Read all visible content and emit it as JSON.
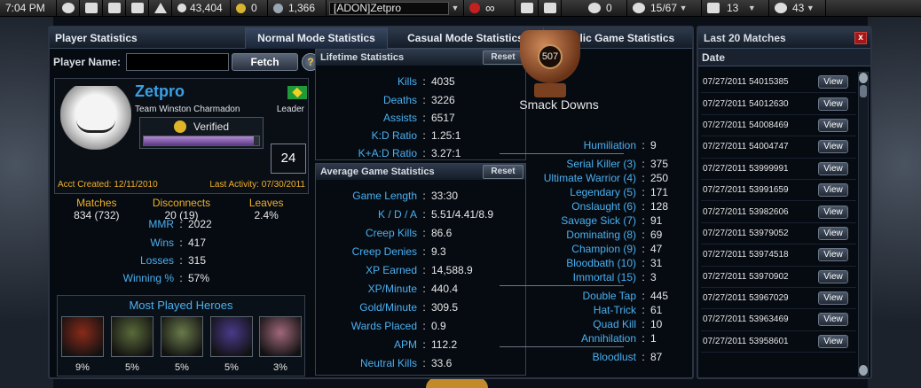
{
  "topbar": {
    "time": "7:04 PM",
    "gold": "43,404",
    "coins": "0",
    "silver": "1,366",
    "nickname": "[ADON]Zetpro",
    "infinity": "∞",
    "messages": "0",
    "friends": "15/67",
    "clan": "13",
    "notices": "43"
  },
  "tabs": {
    "player_statistics": "Player Statistics",
    "normal": "Normal Mode Statistics",
    "casual": "Casual Mode Statistics",
    "public": "Public Game Statistics"
  },
  "fetch": {
    "label": "Player Name:",
    "value": "",
    "button": "Fetch",
    "help": "?"
  },
  "player": {
    "name": "Zetpro",
    "team": "Team Winston Charmadon",
    "role": "Leader",
    "verified": "Verified",
    "level": "24",
    "level_progress": 0.95,
    "acct_created_label": "Acct Created:",
    "acct_created": "12/11/2010",
    "last_activity_label": "Last Activity:",
    "last_activity": "07/30/2011"
  },
  "summary": [
    {
      "label": "Matches",
      "value": "834 (732)"
    },
    {
      "label": "Disconnects",
      "value": "20 (19)"
    },
    {
      "label": "Leaves",
      "value": "2.4%"
    }
  ],
  "rating": [
    {
      "label": "MMR",
      "value": "2022"
    },
    {
      "label": "Wins",
      "value": "417"
    },
    {
      "label": "Losses",
      "value": "315"
    },
    {
      "label": "Winning %",
      "value": "57%"
    }
  ],
  "heroes": {
    "title": "Most Played Heroes",
    "items": [
      {
        "pct": "9%",
        "color": "#8a2a1a"
      },
      {
        "pct": "5%",
        "color": "#5a6a3a"
      },
      {
        "pct": "5%",
        "color": "#6a7a4a"
      },
      {
        "pct": "5%",
        "color": "#4a3a8a"
      },
      {
        "pct": "3%",
        "color": "#a0687a"
      }
    ]
  },
  "lifetime": {
    "title": "Lifetime Statistics",
    "reset": "Reset",
    "rows": [
      {
        "label": "Kills",
        "value": "4035"
      },
      {
        "label": "Deaths",
        "value": "3226"
      },
      {
        "label": "Assists",
        "value": "6517"
      },
      {
        "label": "K:D Ratio",
        "value": "1.25:1"
      },
      {
        "label": "K+A:D Ratio",
        "value": "3.27:1"
      }
    ]
  },
  "average": {
    "title": "Average Game Statistics",
    "reset": "Reset",
    "rows": [
      {
        "label": "Game Length",
        "value": "33:30"
      },
      {
        "label": "K / D / A",
        "value": "5.51/4.41/8.9"
      },
      {
        "label": "Creep Kills",
        "value": "86.6"
      },
      {
        "label": "Creep Denies",
        "value": "9.3"
      },
      {
        "label": "XP Earned",
        "value": "14,588.9"
      },
      {
        "label": "XP/Minute",
        "value": "440.4"
      },
      {
        "label": "Gold/Minute",
        "value": "309.5"
      },
      {
        "label": "Wards Placed",
        "value": "0.9"
      },
      {
        "label": "APM",
        "value": "112.2"
      },
      {
        "label": "Neutral Kills",
        "value": "33.6"
      }
    ]
  },
  "smackdowns": {
    "trophy_number": "507",
    "title": "Smack Downs",
    "humiliation": {
      "label": "Humiliation",
      "value": "9"
    },
    "streaks": [
      {
        "label": "Serial Killer (3)",
        "value": "375"
      },
      {
        "label": "Ultimate Warrior (4)",
        "value": "250"
      },
      {
        "label": "Legendary (5)",
        "value": "171"
      },
      {
        "label": "Onslaught (6)",
        "value": "128"
      },
      {
        "label": "Savage Sick (7)",
        "value": "91"
      },
      {
        "label": "Dominating (8)",
        "value": "69"
      },
      {
        "label": "Champion (9)",
        "value": "47"
      },
      {
        "label": "Bloodbath (10)",
        "value": "31"
      },
      {
        "label": "Immortal (15)",
        "value": "3"
      }
    ],
    "multi": [
      {
        "label": "Double Tap",
        "value": "445"
      },
      {
        "label": "Hat-Trick",
        "value": "61"
      },
      {
        "label": "Quad Kill",
        "value": "10"
      },
      {
        "label": "Annihilation",
        "value": "1"
      }
    ],
    "bloodlust": {
      "label": "Bloodlust",
      "value": "87"
    }
  },
  "matches": {
    "title": "Last 20 Matches",
    "close": "x",
    "date_header": "Date",
    "view": "View",
    "rows": [
      "07/27/2011  54015385",
      "07/27/2011  54012630",
      "07/27/2011  54008469",
      "07/27/2011  54004747",
      "07/27/2011  53999991",
      "07/27/2011  53991659",
      "07/27/2011  53982606",
      "07/27/2011  53979052",
      "07/27/2011  53974518",
      "07/27/2011  53970902",
      "07/27/2011  53967029",
      "07/27/2011  53963469",
      "07/27/2011  53958601"
    ]
  }
}
